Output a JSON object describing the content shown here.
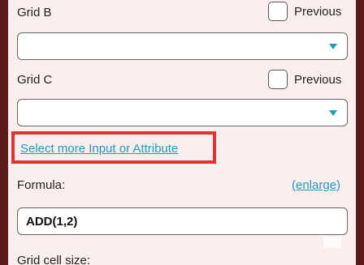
{
  "grid_b": {
    "label": "Grid B",
    "previous_label": "Previous",
    "selected_value": ""
  },
  "grid_c": {
    "label": "Grid C",
    "previous_label": "Previous",
    "selected_value": ""
  },
  "select_more_link": "Select more Input or Attribute",
  "formula": {
    "label": "Formula:",
    "enlarge_link": "(enlarge)",
    "value": "ADD(1,2)"
  },
  "grid_cell_size": {
    "label": "Grid cell size:"
  }
}
